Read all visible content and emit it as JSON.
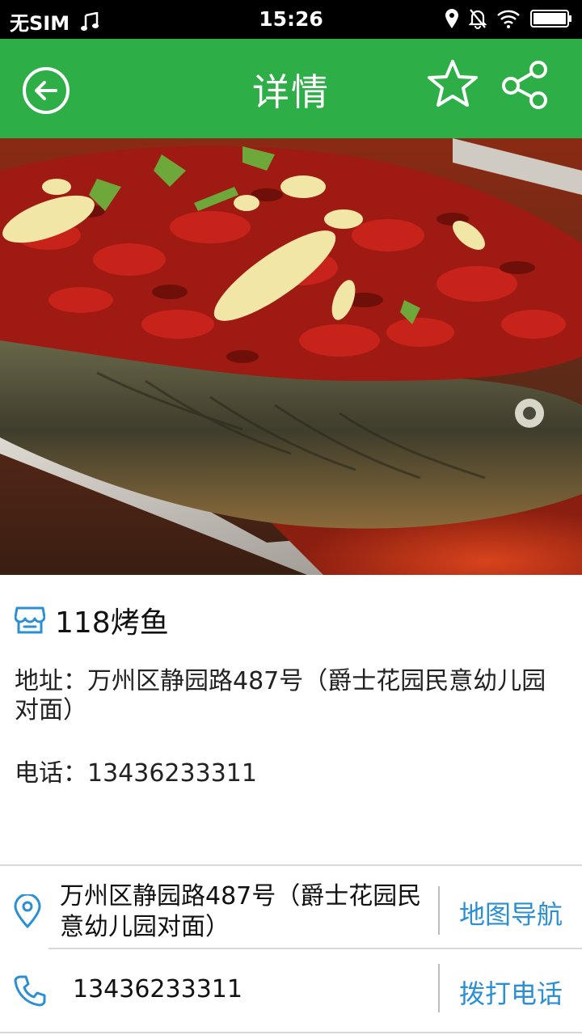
{
  "status_bar": {
    "carrier": "无SIM",
    "time": "15:26",
    "icons": [
      "music-icon",
      "location-icon",
      "mute-icon",
      "wifi-icon",
      "battery-icon"
    ]
  },
  "header": {
    "title": "详情",
    "background": "#2eae46",
    "icons": [
      "back-icon",
      "star-icon",
      "share-icon"
    ]
  },
  "shop": {
    "name": "118烤鱼",
    "address_line": "地址：万州区静园路487号（爵士花园民意幼儿园对面）",
    "phone_line": "电话：13436233311"
  },
  "actions": {
    "address": "万州区静园路487号（爵士花园民意幼儿园对面）",
    "navigate_label": "地图导航",
    "phone": "13436233311",
    "call_label": "拨打电话",
    "accent": "#2b8fd3"
  }
}
